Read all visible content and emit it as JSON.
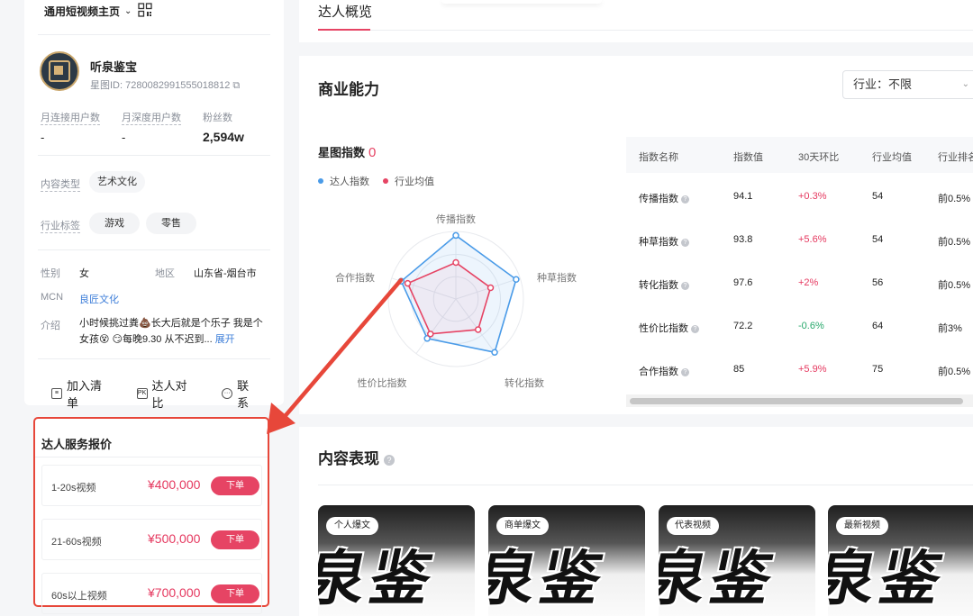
{
  "topbar": {
    "page_select": "通用短视频主页"
  },
  "profile": {
    "name": "听泉鉴宝",
    "id_label": "星图ID: 7280082991555018812",
    "stats": [
      {
        "label": "月连接用户数",
        "value": "-"
      },
      {
        "label": "月深度用户数",
        "value": "-"
      },
      {
        "label": "粉丝数",
        "value": "2,594w"
      }
    ],
    "content_type_label": "内容类型",
    "content_type": "艺术文化",
    "industry_label": "行业标签",
    "industry_tags": [
      "游戏",
      "零售"
    ],
    "gender_label": "性别",
    "gender": "女",
    "region_label": "地区",
    "region": "山东省-烟台市",
    "mcn_label": "MCN",
    "mcn": "良匠文化",
    "bio_label": "介绍",
    "bio": "小时候挑过粪💩长大后就是个乐子 我是个女孩😵 😏每晚9.30 从不迟到...",
    "expand": "展开",
    "actions": {
      "add_list": "加入清单",
      "compare": "达人对比",
      "contact": "联系"
    }
  },
  "price_card": {
    "title": "达人服务报价",
    "rows": [
      {
        "name": "1-20s视频",
        "price": "¥400,000",
        "button": "下单"
      },
      {
        "name": "21-60s视频",
        "price": "¥500,000",
        "button": "下单"
      },
      {
        "name": "60s以上视频",
        "price": "¥700,000",
        "button": "下单"
      }
    ]
  },
  "tabs": {
    "overview": "达人概览"
  },
  "business": {
    "title": "商业能力",
    "industry_filter": "行业：不限",
    "xingtu_label": "星图指数",
    "xingtu_value": "0",
    "legend": [
      {
        "name": "达人指数",
        "color": "#4a9be8"
      },
      {
        "name": "行业均值",
        "color": "#e64464"
      }
    ],
    "radar_axes": [
      "传播指数",
      "种草指数",
      "转化指数",
      "性价比指数",
      "合作指数"
    ],
    "radar_creator": [
      94.1,
      93.8,
      97.6,
      72.2,
      85
    ],
    "radar_industry": [
      54,
      54,
      56,
      64,
      75
    ],
    "table": {
      "headers": [
        "指数名称",
        "指数值",
        "30天环比",
        "行业均值",
        "行业排名"
      ],
      "rows": [
        {
          "name": "传播指数",
          "value": "94.1",
          "change": "+0.3%",
          "trend": "up",
          "avg": "54",
          "rank": "前0.5%"
        },
        {
          "name": "种草指数",
          "value": "93.8",
          "change": "+5.6%",
          "trend": "up",
          "avg": "54",
          "rank": "前0.5%"
        },
        {
          "name": "转化指数",
          "value": "97.6",
          "change": "+2%",
          "trend": "up",
          "avg": "56",
          "rank": "前0.5%"
        },
        {
          "name": "性价比指数",
          "value": "72.2",
          "change": "-0.6%",
          "trend": "down",
          "avg": "64",
          "rank": "前3%"
        },
        {
          "name": "合作指数",
          "value": "85",
          "change": "+5.9%",
          "trend": "up",
          "avg": "75",
          "rank": "前0.5%"
        }
      ]
    }
  },
  "content": {
    "title": "内容表现",
    "cards": [
      "个人爆文",
      "商单爆文",
      "代表视频",
      "最新视频"
    ],
    "art_text": "泉鉴"
  },
  "colors": {
    "accent": "#e64464",
    "arrow": "#e7473a",
    "link": "#3f7fd9"
  }
}
